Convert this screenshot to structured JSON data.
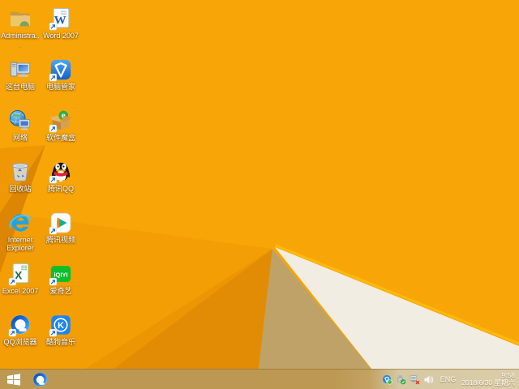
{
  "desktop": {
    "icons": [
      {
        "label": "Administra...",
        "name": "administrator-folder"
      },
      {
        "label": "Word 2007",
        "name": "word-2007",
        "shortcut": true
      },
      {
        "label": "这台电脑",
        "name": "this-pc"
      },
      {
        "label": "电脑管家",
        "name": "pc-manager",
        "shortcut": true
      },
      {
        "label": "网络",
        "name": "network"
      },
      {
        "label": "软件魔盒",
        "name": "software-magic-box",
        "shortcut": true
      },
      {
        "label": "回收站",
        "name": "recycle-bin"
      },
      {
        "label": "腾讯QQ",
        "name": "tencent-qq",
        "shortcut": true
      },
      {
        "label": "Internet Explorer",
        "name": "internet-explorer"
      },
      {
        "label": "腾讯视频",
        "name": "tencent-video",
        "shortcut": true
      },
      {
        "label": "Excel 2007",
        "name": "excel-2007",
        "shortcut": true
      },
      {
        "label": "爱奇艺",
        "name": "iqiyi",
        "shortcut": true
      },
      {
        "label": "QQ浏览器",
        "name": "qq-browser",
        "shortcut": true
      },
      {
        "label": "酷狗音乐",
        "name": "kugou-music",
        "shortcut": true
      }
    ]
  },
  "taskbar": {
    "start_button": "windows-start",
    "pinned": [
      {
        "name": "qq-browser"
      }
    ],
    "tray": {
      "icons": [
        "pc-manager-tray",
        "safely-remove-hardware",
        "network-disconnected",
        "volume"
      ],
      "language": "ENG",
      "time": "9:58",
      "date": "2018/6/30 星期六"
    }
  },
  "wallpaper": {
    "style": "windows-8.1-folded-paper",
    "base_color": "#F8A607",
    "fold_white": "#F2EDE3",
    "fold_tan": "#BEA268",
    "fold_dark": "#E18C04",
    "edge_highlight": "#FFB90A",
    "taskbar_tint": "#BC9852"
  }
}
